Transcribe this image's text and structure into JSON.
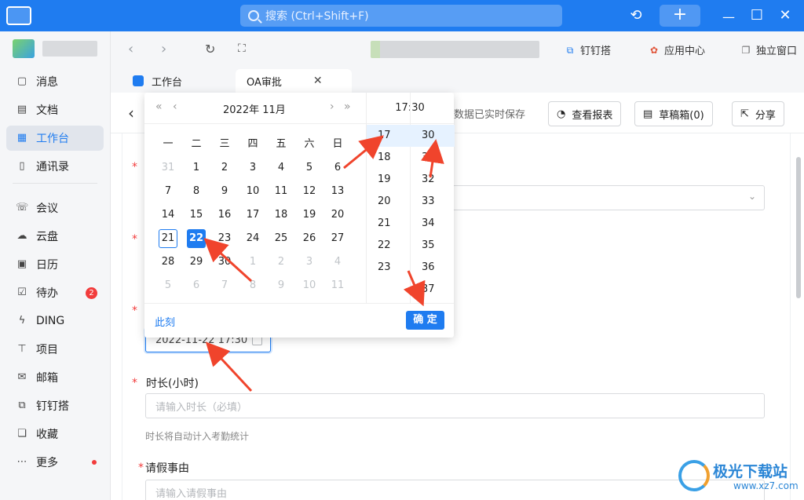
{
  "titlebar": {
    "search_placeholder": "搜索 (Ctrl+Shift+F)"
  },
  "toolbar": {
    "dingdingda": "钉钉搭",
    "app_center": "应用中心",
    "standalone_window": "独立窗口"
  },
  "sidebar": {
    "items": [
      {
        "label": "消息",
        "icon": "message-icon",
        "glyph": "▢"
      },
      {
        "label": "文档",
        "icon": "doc-icon",
        "glyph": "▤"
      },
      {
        "label": "工作台",
        "icon": "grid-icon",
        "glyph": "▦"
      },
      {
        "label": "通讯录",
        "icon": "contacts-icon",
        "glyph": "▯"
      },
      {
        "label": "会议",
        "icon": "phone-icon",
        "glyph": "☏"
      },
      {
        "label": "云盘",
        "icon": "cloud-icon",
        "glyph": "☁"
      },
      {
        "label": "日历",
        "icon": "calendar-icon",
        "glyph": "▣"
      },
      {
        "label": "待办",
        "icon": "todo-icon",
        "glyph": "☑"
      },
      {
        "label": "DING",
        "icon": "bolt-icon",
        "glyph": "ϟ"
      },
      {
        "label": "项目",
        "icon": "project-icon",
        "glyph": "⊤"
      },
      {
        "label": "邮箱",
        "icon": "mail-icon",
        "glyph": "✉"
      },
      {
        "label": "钉钉搭",
        "icon": "dingdingda-icon",
        "glyph": "⧉"
      },
      {
        "label": "收藏",
        "icon": "favorite-icon",
        "glyph": "❏"
      },
      {
        "label": "更多",
        "icon": "more-icon",
        "glyph": "⋯"
      }
    ],
    "todo_badge": "2"
  },
  "tabs": [
    {
      "label": "工作台"
    },
    {
      "label": "OA审批"
    }
  ],
  "form": {
    "autosave_text": "数据已实时保存",
    "report_button": "查看报表",
    "drafts_button": "草稿箱(0)",
    "share_button": "分享",
    "datetime_value": "2022-11-22 17:30",
    "duration_label": "时长(小时)",
    "duration_placeholder": "请输入时长（必填）",
    "duration_hint": "时长将自动计入考勤统计",
    "reason_label": "请假事由",
    "reason_placeholder": "请输入请假事由"
  },
  "picker": {
    "year_month": "2022年  11月",
    "time_display": "17:30",
    "weekdays": [
      "一",
      "二",
      "三",
      "四",
      "五",
      "六",
      "日"
    ],
    "weeks": [
      [
        "31",
        "1",
        "2",
        "3",
        "4",
        "5",
        "6"
      ],
      [
        "7",
        "8",
        "9",
        "10",
        "11",
        "12",
        "13"
      ],
      [
        "14",
        "15",
        "16",
        "17",
        "18",
        "19",
        "20"
      ],
      [
        "21",
        "22",
        "23",
        "24",
        "25",
        "26",
        "27"
      ],
      [
        "28",
        "29",
        "30",
        "1",
        "2",
        "3",
        "4"
      ],
      [
        "5",
        "6",
        "7",
        "8",
        "9",
        "10",
        "11"
      ]
    ],
    "hours": [
      "17",
      "18",
      "19",
      "20",
      "21",
      "22",
      "23"
    ],
    "minutes": [
      "30",
      "31",
      "32",
      "33",
      "34",
      "35",
      "36",
      "37"
    ],
    "now_label": "此刻",
    "confirm_label": "确 定"
  },
  "watermark": {
    "title": "极光下载站",
    "url": "www.xz7.com"
  },
  "colors": {
    "accent": "#1f7cf0",
    "annotation_arrow": "#f0442c",
    "required_star": "#f23c3c"
  }
}
